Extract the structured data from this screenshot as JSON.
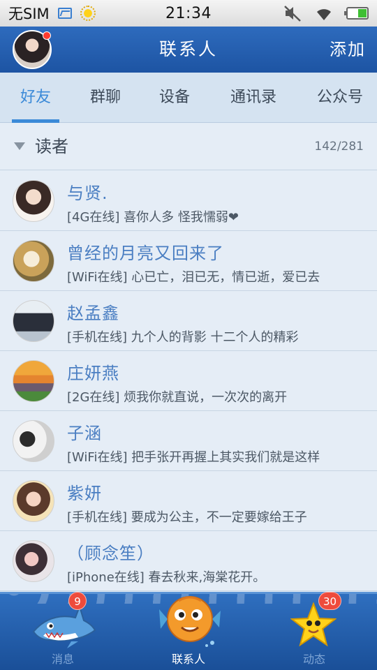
{
  "status_bar": {
    "carrier": "无SIM",
    "time": "21:34",
    "icons": [
      "sim-card-icon",
      "weather-sun-icon",
      "mute-icon",
      "wifi-icon",
      "battery-icon"
    ]
  },
  "header": {
    "title": "联系人",
    "add_label": "添加",
    "avatar_has_notification": true
  },
  "tabs": [
    {
      "label": "好友",
      "active": true
    },
    {
      "label": "群聊",
      "active": false
    },
    {
      "label": "设备",
      "active": false
    },
    {
      "label": "通讯录",
      "active": false
    },
    {
      "label": "公众号",
      "active": false
    }
  ],
  "group": {
    "name": "读者",
    "count": "142/281"
  },
  "contacts": [
    {
      "name": "与贤.",
      "status": "[4G在线] 喜你人多  怪我懦弱❤"
    },
    {
      "name": "曾经的月亮又回来了",
      "status": "[WiFi在线] 心已亡，泪已无，情已逝，爱已去"
    },
    {
      "name": "赵孟鑫",
      "status": "[手机在线] 九个人的背影  十二个人的精彩"
    },
    {
      "name": "庄妍燕",
      "status": "[2G在线] 烦我你就直说，一次次的离开"
    },
    {
      "name": "子涵",
      "status": "[WiFi在线] 把手张开再握上其实我们就是这样"
    },
    {
      "name": "紫妍",
      "status": "[手机在线] 要成为公主，不一定要嫁给王子"
    },
    {
      "name": "（顾念笙）",
      "status": "[iPhone在线] 春去秋来,海棠花开。"
    }
  ],
  "bottom_nav": [
    {
      "label": "消息",
      "badge": "9",
      "icon": "shark-icon",
      "active": false
    },
    {
      "label": "联系人",
      "badge": "",
      "icon": "fish-icon",
      "active": true
    },
    {
      "label": "动态",
      "badge": "30",
      "icon": "star-icon",
      "active": false
    }
  ],
  "colors": {
    "header_blue": "#1d54a3",
    "tab_active": "#3b8ad8",
    "name_blue": "#4a7ec2",
    "badge_red": "#ee4b3c",
    "list_bg": "#e5edf6"
  }
}
